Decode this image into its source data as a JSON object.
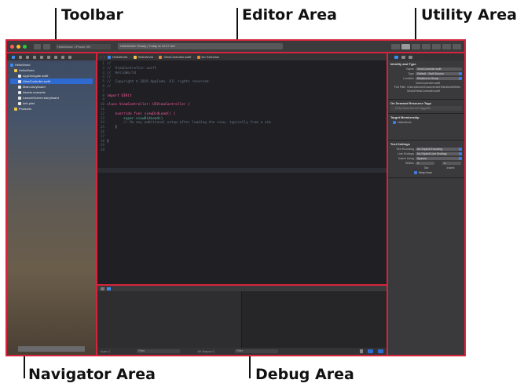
{
  "callouts": {
    "toolbar": "Toolbar",
    "editor": "Editor Area",
    "utility": "Utility Area",
    "navigator": "Navigator Area",
    "debug": "Debug Area"
  },
  "toolbar": {
    "scheme": "HelloWorld  ›  iPhone XR",
    "status": "HelloWorld: Ready  |  Today at 10:27 AM"
  },
  "navigator": {
    "items": [
      {
        "label": "HelloWorld",
        "indent": 0,
        "kind": "project"
      },
      {
        "label": "HelloWorld",
        "indent": 1,
        "kind": "folder"
      },
      {
        "label": "AppDelegate.swift",
        "indent": 2,
        "kind": "file"
      },
      {
        "label": "ViewController.swift",
        "indent": 2,
        "kind": "file",
        "selected": true
      },
      {
        "label": "Main.storyboard",
        "indent": 2,
        "kind": "file"
      },
      {
        "label": "Assets.xcassets",
        "indent": 2,
        "kind": "file"
      },
      {
        "label": "LaunchScreen.storyboard",
        "indent": 2,
        "kind": "file"
      },
      {
        "label": "Info.plist",
        "indent": 2,
        "kind": "file"
      },
      {
        "label": "Products",
        "indent": 1,
        "kind": "folder"
      }
    ]
  },
  "editor": {
    "jumpbar": [
      "HelloWorld",
      "HelloWorld",
      "ViewController.swift",
      "No Selection"
    ],
    "lines": [
      {
        "n": "1",
        "text": "//",
        "cls": "comment"
      },
      {
        "n": "2",
        "text": "//  ViewController.swift",
        "cls": "comment"
      },
      {
        "n": "3",
        "text": "//  HelloWorld",
        "cls": "comment"
      },
      {
        "n": "4",
        "text": "//",
        "cls": "comment"
      },
      {
        "n": "5",
        "text": "//  Copyright © 2019 AppCoda. All rights reserved.",
        "cls": "comment"
      },
      {
        "n": "6",
        "text": "//",
        "cls": "comment"
      },
      {
        "n": "7",
        "text": "",
        "cls": "plain"
      },
      {
        "n": "8",
        "text": "import UIKit",
        "cls": "kw"
      },
      {
        "n": "9",
        "text": "",
        "cls": "plain"
      },
      {
        "n": "10",
        "text": "class ViewController: UIViewController {",
        "cls": "kw"
      },
      {
        "n": "11",
        "text": "",
        "cls": "plain"
      },
      {
        "n": "12",
        "text": "    override func viewDidLoad() {",
        "cls": "kw"
      },
      {
        "n": "13",
        "text": "        super.viewDidLoad()",
        "cls": "fn"
      },
      {
        "n": "14",
        "text": "        // Do any additional setup after loading the view, typically from a nib.",
        "cls": "comment"
      },
      {
        "n": "15",
        "text": "    }",
        "cls": "plain"
      },
      {
        "n": "16",
        "text": "",
        "cls": "plain"
      },
      {
        "n": "17",
        "text": "",
        "cls": "plain"
      },
      {
        "n": "18",
        "text": "}",
        "cls": "plain"
      },
      {
        "n": "19",
        "text": "",
        "cls": "plain"
      },
      {
        "n": "20",
        "text": "",
        "cls": "plain"
      }
    ]
  },
  "debug": {
    "footer_left": "Auto ◇",
    "filter_placeholder": "Filter",
    "output_label": "All Output ◇",
    "console_filter": "Filter"
  },
  "utility": {
    "identity": {
      "heading": "Identity and Type",
      "name_label": "Name",
      "name_value": "ViewController.swift",
      "type_label": "Type",
      "type_value": "Default - Swift Source",
      "location_label": "Location",
      "location_value": "Relative to Group",
      "location_file": "ViewController.swift",
      "fullpath_label": "Full Path",
      "fullpath_value": "/Users/simon/Documents/HelloWorld/HelloWorld/ViewController.swift"
    },
    "ondemand": {
      "heading": "On Demand Resource Tags",
      "placeholder": "Only resources are taggable"
    },
    "membership": {
      "heading": "Target Membership",
      "target": "HelloWorld"
    },
    "text_settings": {
      "heading": "Text Settings",
      "encoding_label": "Text Encoding",
      "encoding_value": "No Explicit Encoding",
      "endings_label": "Line Endings",
      "endings_value": "No Explicit Line Endings",
      "indent_label": "Indent Using",
      "indent_value": "Spaces",
      "widths_label": "Widths",
      "tab_value": "4",
      "indent_num": "4",
      "tab_caption": "Tab",
      "indent_caption": "Indent",
      "wrap_label": "Wrap lines"
    }
  },
  "colors": {
    "accent_red": "#d5243b",
    "selection_blue": "#2f6ad0",
    "comment": "#6c7986",
    "keyword": "#fc5fa3",
    "type": "#5dd8ff",
    "function": "#67b7a4",
    "plain": "#dfdfe0"
  }
}
